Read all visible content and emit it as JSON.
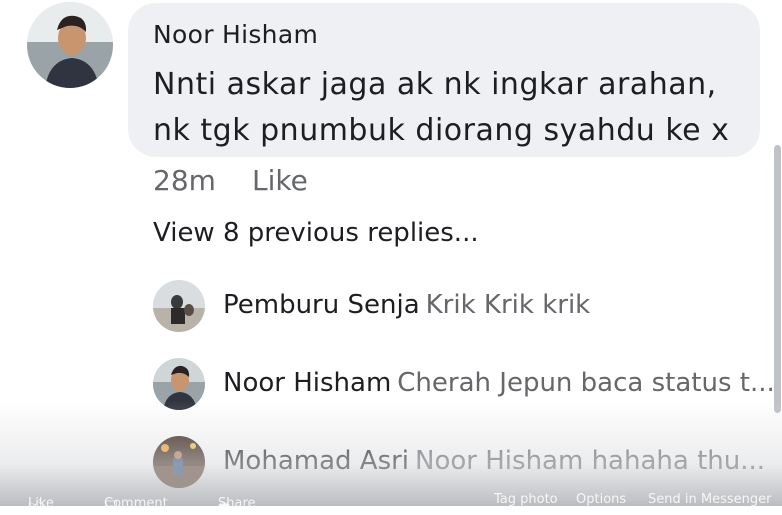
{
  "comment": {
    "author": "Noor Hisham",
    "text": "Nnti askar jaga ak nk ingkar arahan, nk tgk pnumbuk diorang syahdu ke x",
    "time": "28m",
    "like_label": "Like"
  },
  "view_previous_label": "View 8 previous replies...",
  "replies": [
    {
      "name": "Pemburu Senja",
      "text": "Krik Krik krik"
    },
    {
      "name": "Noor Hisham",
      "text": "Cherah Jepun baca status t..."
    },
    {
      "name": "Mohamad Asri",
      "text": "Noor Hisham hahaha thu..."
    }
  ],
  "action_bar": {
    "like": "Like",
    "comment": "Comment",
    "share": "Share",
    "tag_photo": "Tag photo",
    "options": "Options",
    "send": "Send in Messenger"
  },
  "colors": {
    "bubble": "#eef0f3",
    "secondary_text": "#65676b",
    "primary_text": "#1c1e21"
  }
}
